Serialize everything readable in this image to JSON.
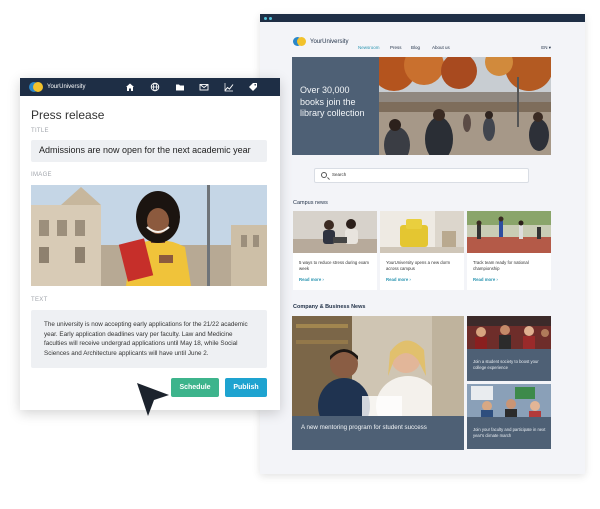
{
  "site": {
    "logo_text": "YourUniversity",
    "nav": [
      "Newsroom",
      "Press",
      "Blog",
      "About us"
    ],
    "language": "EN ▾",
    "hero_text": "Over 30,000 books join the library collection",
    "search_placeholder": "Search",
    "campus_title": "Campus news",
    "campus_news": [
      {
        "text": "5 ways to reduce stress during exam week",
        "link": "Read more ›"
      },
      {
        "text": "YourUniversity opens a new dorm across campus",
        "link": "Read more ›"
      },
      {
        "text": "Track team ready for national championship",
        "link": "Read more ›"
      }
    ],
    "business_title": "Company & Business News",
    "feature_caption": "A new mentoring program for student success",
    "side_stories": [
      {
        "text": "Join a student society to boost your college experience"
      },
      {
        "text": "Join your faculty and participate in next year's climate march"
      }
    ]
  },
  "editor": {
    "logo_text": "YourUniversity",
    "toolbar_icons": [
      "home-icon",
      "globe-icon",
      "folder-icon",
      "mail-icon",
      "chart-icon",
      "tag-icon"
    ],
    "title": "Press release",
    "title_label": "TITLE",
    "title_value": "Admissions are now open for the next academic year",
    "image_label": "IMAGE",
    "text_label": "TEXT",
    "text_value": "The university is now accepting early applications for the 21/22 academic year. Early application deadlines vary per faculty. Law and Medicine faculties will receive undergrad applications until May 18, while Social Sciences and Architecture applicants will have until June 2.",
    "schedule_label": "Schedule",
    "publish_label": "Publish"
  },
  "colors": {
    "navy": "#1e2e45",
    "slate": "#4e6075",
    "accent_teal": "#2a94b0",
    "schedule_green": "#3db48c",
    "publish_blue": "#1ea3d0"
  }
}
